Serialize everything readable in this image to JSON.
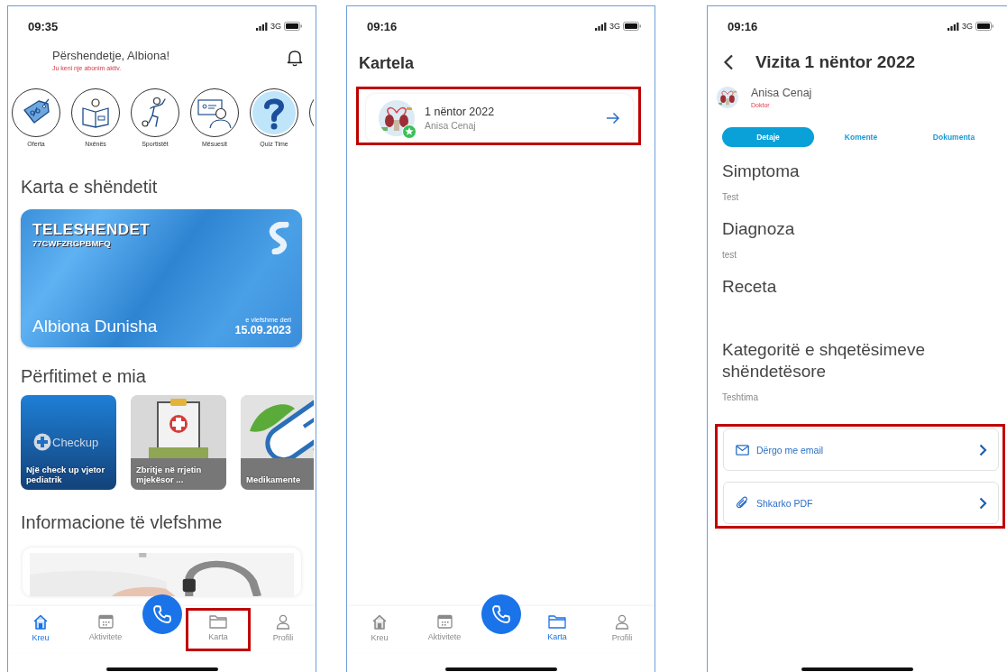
{
  "screens": [
    {
      "kind": "home",
      "status_bar": {
        "time": "09:35",
        "network": "3G"
      },
      "greeting": "Përshendetje, Albiona!",
      "subscription_note": "Ju keni nje abonim aktiv.",
      "categories": [
        {
          "label": "Oferta"
        },
        {
          "label": "Nxënës"
        },
        {
          "label": "Sportistët"
        },
        {
          "label": "Mësuesit"
        },
        {
          "label": "Quiz Time"
        }
      ],
      "health_card": {
        "title": "Karta e shëndetit",
        "brand": "TELESHENDET",
        "code": "77CWFZRGPBMFQ",
        "holder": "Albiona Dunisha",
        "valid_label": "e vlefshme deri",
        "valid_until": "15.09.2023"
      },
      "benefits": {
        "title": "Përfitimet e mia",
        "items": [
          {
            "kind": "logo",
            "logo_text": "Checkup",
            "caption": "Një check up vjetor pediatrik"
          },
          {
            "kind": "picture",
            "caption": "Zbritje në rrjetin mjekësor ..."
          },
          {
            "kind": "picture",
            "caption": "Medikamente"
          }
        ]
      },
      "info": {
        "title": "Informacione të vlefshme"
      },
      "nav": [
        {
          "label": "Kreu",
          "selected": true,
          "highlighted": false
        },
        {
          "label": "Aktivitete",
          "selected": false,
          "highlighted": false
        },
        {
          "label": "Karta",
          "selected": false,
          "highlighted": true
        },
        {
          "label": "Profili",
          "selected": false,
          "highlighted": false
        }
      ]
    },
    {
      "kind": "records",
      "status_bar": {
        "time": "09:16",
        "network": "3G"
      },
      "title": "Kartela",
      "visits": [
        {
          "date": "1 nëntor 2022",
          "doctor": "Anisa Cenaj",
          "highlighted": true
        }
      ],
      "nav": [
        {
          "label": "Kreu",
          "selected": false,
          "highlighted": false
        },
        {
          "label": "Aktivitete",
          "selected": false,
          "highlighted": false
        },
        {
          "label": "Karta",
          "selected": true,
          "highlighted": false
        },
        {
          "label": "Profili",
          "selected": false,
          "highlighted": false
        }
      ]
    },
    {
      "kind": "visit_detail",
      "status_bar": {
        "time": "09:16",
        "network": "3G"
      },
      "title": "Vizita 1 nëntor 2022",
      "doctor": {
        "name": "Anisa Cenaj",
        "role": "Doktor"
      },
      "tabs": [
        {
          "label": "Detaje",
          "selected": true
        },
        {
          "label": "Komente",
          "selected": false
        },
        {
          "label": "Dokumenta",
          "selected": false
        }
      ],
      "sections": [
        {
          "heading": "Simptoma",
          "value": "Test"
        },
        {
          "heading": "Diagnoza",
          "value": "test"
        },
        {
          "heading": "Receta"
        },
        {
          "heading": "Kategoritë e shqetësimeve shëndetësore",
          "value": "Teshtima"
        }
      ],
      "actions": {
        "highlighted": true,
        "items": [
          {
            "kind": "email",
            "label": "Dërgo me email"
          },
          {
            "kind": "attachment",
            "label": "Shkarko PDF"
          }
        ]
      }
    }
  ]
}
